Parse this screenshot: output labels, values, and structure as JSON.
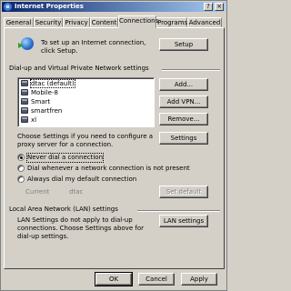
{
  "window": {
    "title": "Internet Properties",
    "icon": "ie-icon",
    "controls": {
      "help": "?",
      "close": "×"
    }
  },
  "tabs": [
    "General",
    "Security",
    "Privacy",
    "Content",
    "Connections",
    "Programs",
    "Advanced"
  ],
  "active_tab": "Connections",
  "setup": {
    "text": "To set up an Internet connection, click Setup.",
    "button": "Setup"
  },
  "dialup": {
    "heading": "Dial-up and Virtual Private Network settings",
    "connections": [
      "dtac (default)",
      "Mobile-8",
      "Smart",
      "smartfren",
      "xl"
    ],
    "buttons": {
      "add": "Add...",
      "add_vpn": "Add VPN...",
      "remove": "Remove..."
    },
    "proxy_text": "Choose Settings if you need to configure a proxy server for a connection.",
    "settings_button": "Settings",
    "options": [
      {
        "label": "Never dial a connection",
        "selected": true
      },
      {
        "label": "Dial whenever a network connection is not present",
        "selected": false
      },
      {
        "label": "Always dial my default connection",
        "selected": false
      }
    ],
    "current_label": "Current",
    "current_value": "dtac",
    "set_default_button": "Set default"
  },
  "lan": {
    "heading": "Local Area Network (LAN) settings",
    "text": "LAN Settings do not apply to dial-up connections. Choose Settings above for dial-up settings.",
    "button": "LAN settings"
  },
  "footer": {
    "ok": "OK",
    "cancel": "Cancel",
    "apply": "Apply"
  },
  "colors": {
    "face": "#d4d0c8",
    "title_start": "#0a246a",
    "title_end": "#a6caf0"
  }
}
